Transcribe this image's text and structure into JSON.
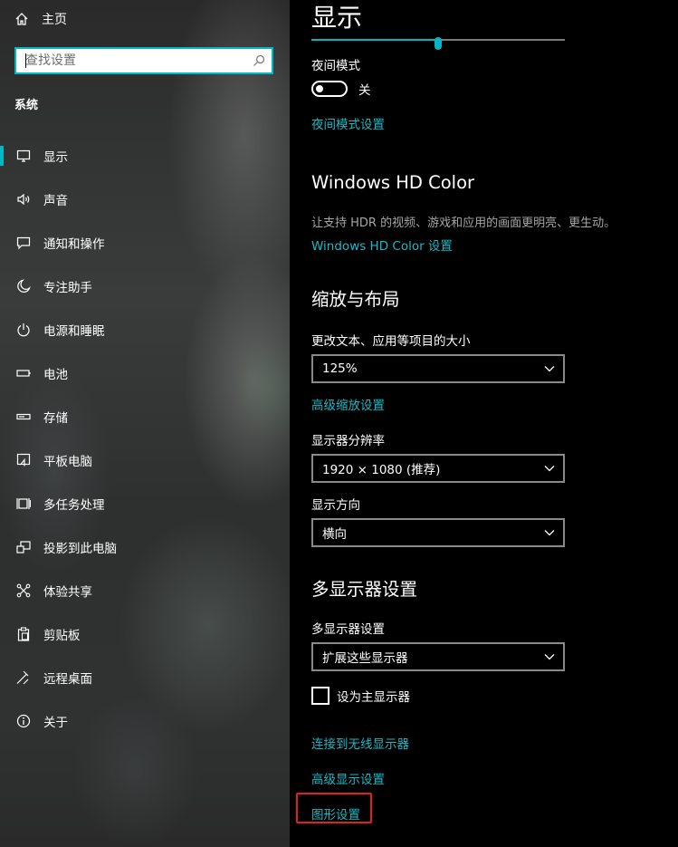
{
  "sidebar": {
    "home_label": "主页",
    "search_placeholder": "查找设置",
    "section_title": "系统",
    "items": [
      {
        "label": "显示",
        "icon": "monitor-icon",
        "active": true
      },
      {
        "label": "声音",
        "icon": "speaker-icon"
      },
      {
        "label": "通知和操作",
        "icon": "notification-icon"
      },
      {
        "label": "专注助手",
        "icon": "moon-icon"
      },
      {
        "label": "电源和睡眠",
        "icon": "power-icon"
      },
      {
        "label": "电池",
        "icon": "battery-icon"
      },
      {
        "label": "存储",
        "icon": "storage-icon"
      },
      {
        "label": "平板电脑",
        "icon": "tablet-icon"
      },
      {
        "label": "多任务处理",
        "icon": "multitask-icon"
      },
      {
        "label": "投影到此电脑",
        "icon": "project-icon"
      },
      {
        "label": "体验共享",
        "icon": "share-icon"
      },
      {
        "label": "剪贴板",
        "icon": "clipboard-icon"
      },
      {
        "label": "远程桌面",
        "icon": "remote-icon"
      },
      {
        "label": "关于",
        "icon": "info-icon"
      }
    ]
  },
  "main": {
    "title": "显示",
    "brightness_level": 0.5,
    "night_light": {
      "label": "夜间模式",
      "state": "关",
      "settings_link": "夜间模式设置"
    },
    "hd_color": {
      "heading": "Windows HD Color",
      "description": "让支持 HDR 的视频、游戏和应用的画面更明亮、更生动。",
      "link": "Windows HD Color 设置"
    },
    "scale_layout": {
      "heading": "缩放与布局",
      "scale_label": "更改文本、应用等项目的大小",
      "scale_value": "125%",
      "advanced_scaling_link": "高级缩放设置",
      "resolution_label": "显示器分辨率",
      "resolution_value": "1920 × 1080 (推荐)",
      "orientation_label": "显示方向",
      "orientation_value": "横向"
    },
    "multi_display": {
      "heading": "多显示器设置",
      "label": "多显示器设置",
      "value": "扩展这些显示器",
      "primary_checkbox_label": "设为主显示器",
      "wireless_link": "连接到无线显示器",
      "advanced_link": "高级显示设置",
      "graphics_link": "图形设置"
    }
  },
  "colors": {
    "accent": "#00b7c3",
    "link": "#1db8c4",
    "highlight_border": "#e02020"
  }
}
